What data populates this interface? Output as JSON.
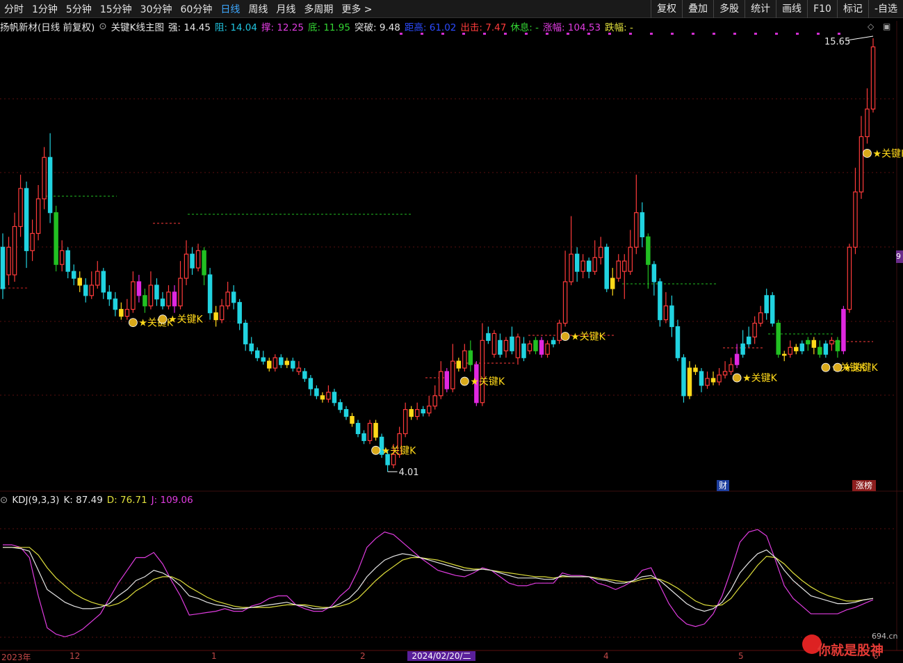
{
  "toolbar": {
    "periods": [
      "分时",
      "1分钟",
      "5分钟",
      "15分钟",
      "30分钟",
      "60分钟",
      "日线",
      "周线",
      "月线",
      "多周期",
      "更多 >"
    ],
    "active_period": "日线",
    "right_buttons": [
      "复权",
      "叠加",
      "多股",
      "统计",
      "画线",
      "F10",
      "标记",
      "-自选"
    ]
  },
  "info": {
    "stock": "扬帆新材(日线 前复权)",
    "indicator": "关键K线主图",
    "items": [
      {
        "label": "强:",
        "value": "14.45",
        "color": "#e6e6e6"
      },
      {
        "label": "阻:",
        "value": "14.04",
        "color": "#21c5e0"
      },
      {
        "label": "撑:",
        "value": "12.25",
        "color": "#e03ce0"
      },
      {
        "label": "底:",
        "value": "11.95",
        "color": "#33d633"
      },
      {
        "label": "突破:",
        "value": "9.48",
        "color": "#e6e6e6"
      },
      {
        "label": "距高:",
        "value": "61.02",
        "color": "#2c4bff"
      },
      {
        "label": "出击:",
        "value": "7.47",
        "color": "#ff3b3b"
      },
      {
        "label": "休息:",
        "value": "-",
        "color": "#33d633"
      },
      {
        "label": "涨幅:",
        "value": "104.53",
        "color": "#e03ce0"
      },
      {
        "label": "跌幅:",
        "value": "-",
        "color": "#e0e03c"
      }
    ]
  },
  "kdj": {
    "name": "KDJ(9,3,3)",
    "items": [
      {
        "label": "K:",
        "value": "87.49",
        "color": "#e6e6e6"
      },
      {
        "label": "D:",
        "value": "76.71",
        "color": "#e0e03c"
      },
      {
        "label": "J:",
        "value": "109.06",
        "color": "#e03ce0"
      }
    ]
  },
  "marks": {
    "high_label": "15.65",
    "low_label": "4.01",
    "key_k_label": "关键K",
    "cai_tag": "财",
    "zb_tag": "涨榜",
    "side_tag": "9"
  },
  "xaxis": {
    "labels": [
      "2023年",
      "12",
      "1",
      "2",
      "2024/02/20/二",
      "4",
      "5",
      "6"
    ]
  },
  "watermark": {
    "text": "你就是股神",
    "url": "694.cn"
  },
  "colors": {
    "up": "#ff3b3b",
    "down": "#21d3e0",
    "hl_down": "#22c022",
    "hl_up": "#e028e0",
    "yellow": "#ffd91a",
    "k": "#e6e6e6",
    "d": "#e0e03c",
    "j": "#e03ce0"
  },
  "chart_data": {
    "type": "candlestick",
    "price_range": [
      4.01,
      15.65
    ],
    "candles": [
      [
        8.4,
        9.6,
        10.0,
        8.1,
        "down"
      ],
      [
        9.6,
        8.8,
        9.9,
        8.5,
        "up"
      ],
      [
        8.8,
        10.2,
        10.6,
        8.6,
        "up"
      ],
      [
        10.2,
        11.3,
        11.7,
        9.9,
        "up"
      ],
      [
        11.3,
        9.5,
        11.5,
        9.0,
        "down"
      ],
      [
        9.5,
        10.0,
        10.4,
        9.2,
        "up"
      ],
      [
        10.0,
        11.0,
        11.4,
        9.8,
        "up"
      ],
      [
        11.0,
        12.2,
        12.5,
        10.7,
        "up"
      ],
      [
        12.2,
        10.6,
        12.9,
        10.3,
        "down"
      ],
      [
        10.6,
        9.1,
        10.8,
        8.9,
        "hlgreen"
      ],
      [
        9.1,
        9.5,
        9.8,
        8.9,
        "up"
      ],
      [
        9.5,
        8.9,
        9.6,
        8.7,
        "down"
      ],
      [
        8.9,
        8.7,
        9.1,
        8.5,
        "down"
      ],
      [
        8.7,
        8.5,
        8.9,
        8.3,
        "yellow"
      ],
      [
        8.5,
        8.2,
        8.7,
        8.0,
        "down"
      ],
      [
        8.2,
        8.5,
        8.9,
        8.1,
        "up"
      ],
      [
        8.5,
        8.9,
        9.2,
        8.4,
        "up"
      ],
      [
        8.9,
        8.3,
        9.0,
        8.1,
        "down"
      ],
      [
        8.3,
        8.1,
        8.5,
        7.9,
        "down"
      ],
      [
        8.1,
        7.8,
        8.3,
        7.6,
        "down"
      ],
      [
        7.8,
        7.6,
        8.0,
        7.5,
        "yellow"
      ],
      [
        7.6,
        7.8,
        8.1,
        7.5,
        "up"
      ],
      [
        7.8,
        8.6,
        8.9,
        7.7,
        "up"
      ],
      [
        8.6,
        8.2,
        8.8,
        8.0,
        "hlup"
      ],
      [
        8.2,
        7.9,
        8.4,
        7.7,
        "hlgreen"
      ],
      [
        7.9,
        8.5,
        8.9,
        7.8,
        "up"
      ],
      [
        8.5,
        8.1,
        8.7,
        7.9,
        "down"
      ],
      [
        8.1,
        7.9,
        8.3,
        7.8,
        "down"
      ],
      [
        7.9,
        8.3,
        8.5,
        7.8,
        "up"
      ],
      [
        8.3,
        7.9,
        8.5,
        7.7,
        "hlup"
      ],
      [
        7.9,
        8.7,
        9.2,
        7.8,
        "up"
      ],
      [
        8.7,
        9.4,
        9.8,
        8.5,
        "up"
      ],
      [
        9.4,
        9.0,
        9.6,
        8.8,
        "down"
      ],
      [
        9.0,
        9.5,
        9.7,
        8.9,
        "up"
      ],
      [
        9.5,
        8.8,
        9.6,
        8.5,
        "hlgreen"
      ],
      [
        8.8,
        7.7,
        9.0,
        7.5,
        "down"
      ],
      [
        7.7,
        7.5,
        7.9,
        7.3,
        "yellow"
      ],
      [
        7.5,
        7.9,
        8.1,
        7.4,
        "up"
      ],
      [
        7.9,
        8.3,
        8.6,
        7.8,
        "up"
      ],
      [
        8.3,
        8.0,
        8.5,
        7.8,
        "down"
      ],
      [
        8.0,
        7.4,
        8.1,
        7.2,
        "down"
      ],
      [
        7.4,
        6.8,
        7.5,
        6.6,
        "down"
      ],
      [
        6.8,
        6.6,
        7.0,
        6.5,
        "down"
      ],
      [
        6.6,
        6.4,
        6.7,
        6.3,
        "down"
      ],
      [
        6.4,
        6.3,
        6.6,
        6.2,
        "down"
      ],
      [
        6.3,
        6.1,
        6.4,
        6.0,
        "yellow"
      ],
      [
        6.1,
        6.4,
        6.5,
        6.0,
        "up"
      ],
      [
        6.4,
        6.2,
        6.5,
        6.1,
        "down"
      ],
      [
        6.2,
        6.3,
        6.4,
        6.1,
        "yellow"
      ],
      [
        6.3,
        6.1,
        6.4,
        6.0,
        "down"
      ],
      [
        6.1,
        6.0,
        6.3,
        5.9,
        "up"
      ],
      [
        6.0,
        5.8,
        6.1,
        5.7,
        "down"
      ],
      [
        5.8,
        5.5,
        5.9,
        5.3,
        "down"
      ],
      [
        5.5,
        5.3,
        5.6,
        5.2,
        "down"
      ],
      [
        5.3,
        5.2,
        5.4,
        5.1,
        "yellow"
      ],
      [
        5.2,
        5.4,
        5.6,
        5.1,
        "up"
      ],
      [
        5.4,
        5.1,
        5.5,
        5.0,
        "down"
      ],
      [
        5.1,
        4.9,
        5.2,
        4.8,
        "down"
      ],
      [
        4.9,
        4.7,
        5.0,
        4.6,
        "down"
      ],
      [
        4.7,
        4.5,
        4.8,
        4.4,
        "yellow"
      ],
      [
        4.5,
        4.2,
        4.6,
        4.1,
        "down"
      ],
      [
        4.2,
        4.0,
        4.3,
        3.9,
        "down"
      ],
      [
        4.0,
        4.5,
        4.6,
        3.9,
        "up"
      ],
      [
        4.5,
        4.1,
        4.6,
        4.0,
        "yellow"
      ],
      [
        4.1,
        3.6,
        4.2,
        3.5,
        "down"
      ],
      [
        3.6,
        3.3,
        3.7,
        3.1,
        "down"
      ],
      [
        3.3,
        3.6,
        3.9,
        3.2,
        "up"
      ],
      [
        3.6,
        4.2,
        4.4,
        3.5,
        "up"
      ],
      [
        4.2,
        4.9,
        5.1,
        4.1,
        "up"
      ],
      [
        4.9,
        4.7,
        5.0,
        4.6,
        "yellow"
      ],
      [
        4.7,
        4.9,
        5.1,
        4.6,
        "up"
      ],
      [
        4.9,
        4.8,
        5.0,
        4.7,
        "down"
      ],
      [
        4.8,
        5.0,
        5.3,
        4.7,
        "up"
      ],
      [
        5.0,
        5.3,
        5.6,
        4.9,
        "up"
      ],
      [
        5.3,
        6.0,
        6.3,
        5.2,
        "up"
      ],
      [
        6.0,
        5.5,
        6.1,
        5.4,
        "hlup"
      ],
      [
        5.5,
        6.3,
        6.8,
        5.4,
        "up"
      ],
      [
        6.3,
        6.1,
        6.4,
        6.0,
        "yellow"
      ],
      [
        6.1,
        6.6,
        6.8,
        6.0,
        "up"
      ],
      [
        6.6,
        6.2,
        6.9,
        6.0,
        "hlgreen"
      ],
      [
        6.2,
        5.1,
        6.3,
        5.0,
        "hlup"
      ],
      [
        5.1,
        6.9,
        7.4,
        5.0,
        "up"
      ],
      [
        6.9,
        7.1,
        7.3,
        6.8,
        "down"
      ],
      [
        7.1,
        6.5,
        7.2,
        6.4,
        "up"
      ],
      [
        6.5,
        6.9,
        7.1,
        6.4,
        "down"
      ],
      [
        6.9,
        6.6,
        7.0,
        6.4,
        "up"
      ],
      [
        6.6,
        7.0,
        7.3,
        6.5,
        "down"
      ],
      [
        7.0,
        6.4,
        7.1,
        6.2,
        "up"
      ],
      [
        6.4,
        6.8,
        7.0,
        6.3,
        "down"
      ],
      [
        6.8,
        6.6,
        6.9,
        6.5,
        "up"
      ],
      [
        6.6,
        6.9,
        7.0,
        6.5,
        "hlgreen"
      ],
      [
        6.9,
        6.5,
        7.0,
        6.4,
        "hlup"
      ],
      [
        6.5,
        6.8,
        6.9,
        6.4,
        "up"
      ],
      [
        6.8,
        6.9,
        7.0,
        6.7,
        "down"
      ],
      [
        6.9,
        7.4,
        7.5,
        6.8,
        "up"
      ],
      [
        7.4,
        8.6,
        9.5,
        7.3,
        "up"
      ],
      [
        8.6,
        9.4,
        10.5,
        8.5,
        "up"
      ],
      [
        9.4,
        8.9,
        9.6,
        8.6,
        "down"
      ],
      [
        8.9,
        9.2,
        9.4,
        8.7,
        "up"
      ],
      [
        9.2,
        8.9,
        9.3,
        8.7,
        "down"
      ],
      [
        8.9,
        9.3,
        9.8,
        8.8,
        "up"
      ],
      [
        9.3,
        9.6,
        9.9,
        9.1,
        "up"
      ],
      [
        9.6,
        8.4,
        9.7,
        8.3,
        "down"
      ],
      [
        8.4,
        8.7,
        9.0,
        8.2,
        "yellow"
      ],
      [
        8.7,
        9.2,
        9.4,
        8.6,
        "up"
      ],
      [
        9.2,
        8.9,
        9.4,
        8.1,
        "up"
      ],
      [
        8.9,
        9.6,
        10.1,
        8.8,
        "up"
      ],
      [
        9.6,
        10.6,
        11.7,
        9.4,
        "up"
      ],
      [
        10.6,
        9.9,
        10.9,
        9.6,
        "down"
      ],
      [
        9.9,
        9.1,
        10.0,
        8.4,
        "hlgreen"
      ],
      [
        9.1,
        8.6,
        9.2,
        8.2,
        "down"
      ],
      [
        8.6,
        7.5,
        8.7,
        7.3,
        "down"
      ],
      [
        7.5,
        7.9,
        8.3,
        7.4,
        "up"
      ],
      [
        7.9,
        7.3,
        8.2,
        7.0,
        "down"
      ],
      [
        7.3,
        6.4,
        7.5,
        6.3,
        "down"
      ],
      [
        6.4,
        5.3,
        6.5,
        5.1,
        "down"
      ],
      [
        5.3,
        6.1,
        6.3,
        5.2,
        "yellow"
      ],
      [
        6.1,
        6.0,
        6.2,
        5.9,
        "yellow"
      ],
      [
        6.0,
        5.6,
        6.1,
        5.4,
        "down"
      ],
      [
        5.6,
        5.8,
        6.0,
        5.5,
        "up"
      ],
      [
        5.8,
        5.7,
        6.0,
        5.6,
        "yellow"
      ],
      [
        5.7,
        5.9,
        6.1,
        5.6,
        "up"
      ],
      [
        5.9,
        6.0,
        6.3,
        5.8,
        "up"
      ],
      [
        6.0,
        6.2,
        6.4,
        5.9,
        "up"
      ],
      [
        6.2,
        6.5,
        6.8,
        6.1,
        "hlup"
      ],
      [
        6.5,
        6.8,
        7.2,
        6.4,
        "down"
      ],
      [
        6.8,
        7.0,
        7.3,
        6.7,
        "down"
      ],
      [
        7.0,
        7.4,
        7.6,
        6.8,
        "up"
      ],
      [
        7.4,
        7.7,
        7.9,
        7.3,
        "up"
      ],
      [
        7.7,
        8.2,
        8.4,
        7.5,
        "down"
      ],
      [
        8.2,
        7.4,
        8.3,
        7.3,
        "down"
      ],
      [
        7.4,
        6.5,
        7.5,
        6.4,
        "hlgreen"
      ],
      [
        6.5,
        6.5,
        6.6,
        6.3,
        "yellow"
      ],
      [
        6.5,
        6.7,
        6.9,
        6.4,
        "up"
      ],
      [
        6.7,
        6.6,
        6.8,
        6.5,
        "yellow"
      ],
      [
        6.6,
        6.8,
        6.9,
        6.5,
        "down"
      ],
      [
        6.8,
        6.9,
        7.0,
        6.6,
        "hlgreen"
      ],
      [
        6.9,
        6.7,
        7.0,
        6.5,
        "yellow"
      ],
      [
        6.7,
        6.5,
        6.9,
        6.4,
        "hlgreen"
      ],
      [
        6.5,
        6.8,
        6.9,
        6.4,
        "down"
      ],
      [
        6.8,
        6.9,
        7.0,
        6.6,
        "up"
      ],
      [
        6.9,
        6.6,
        7.0,
        6.4,
        "hlgreen"
      ],
      [
        6.6,
        7.8,
        7.9,
        6.5,
        "hlup"
      ],
      [
        7.8,
        9.6,
        9.7,
        7.7,
        "up"
      ],
      [
        9.6,
        11.2,
        11.9,
        9.4,
        "up"
      ],
      [
        11.2,
        12.8,
        13.4,
        11.0,
        "up"
      ],
      [
        12.8,
        13.6,
        14.2,
        12.6,
        "up"
      ],
      [
        13.6,
        15.4,
        15.65,
        13.5,
        "up"
      ]
    ],
    "kdj_series": {
      "K": [
        78,
        78,
        77,
        75,
        60,
        45,
        40,
        35,
        32,
        30,
        30,
        31,
        34,
        40,
        45,
        52,
        55,
        60,
        58,
        54,
        48,
        40,
        38,
        35,
        33,
        32,
        30,
        30,
        31,
        32,
        33,
        34,
        35,
        33,
        32,
        30,
        30,
        31,
        34,
        38,
        45,
        55,
        62,
        68,
        71,
        73,
        72,
        70,
        68,
        66,
        64,
        62,
        60,
        60,
        61,
        60,
        58,
        56,
        54,
        54,
        54,
        53,
        53,
        56,
        55,
        55,
        55,
        53,
        52,
        50,
        50,
        52,
        55,
        56,
        52,
        46,
        40,
        34,
        30,
        28,
        30,
        35,
        45,
        58,
        66,
        73,
        76,
        70,
        60,
        52,
        46,
        40,
        38,
        36,
        34,
        34,
        35,
        37,
        38
      ],
      "D": [
        78,
        78,
        78,
        78,
        72,
        62,
        54,
        48,
        42,
        38,
        35,
        33,
        32,
        34,
        38,
        44,
        48,
        53,
        55,
        55,
        52,
        47,
        43,
        39,
        36,
        34,
        32,
        31,
        31,
        31,
        31,
        32,
        33,
        33,
        33,
        32,
        31,
        31,
        32,
        34,
        38,
        45,
        52,
        58,
        63,
        68,
        70,
        70,
        69,
        68,
        66,
        64,
        62,
        61,
        61,
        60,
        59,
        58,
        57,
        56,
        55,
        55,
        54,
        55,
        55,
        55,
        55,
        54,
        53,
        52,
        51,
        51,
        53,
        54,
        53,
        50,
        46,
        41,
        36,
        33,
        32,
        33,
        38,
        47,
        55,
        64,
        71,
        70,
        65,
        58,
        52,
        47,
        43,
        40,
        38,
        36,
        36,
        37,
        38
      ],
      "J": [
        80,
        80,
        78,
        70,
        40,
        15,
        10,
        8,
        10,
        14,
        20,
        26,
        38,
        50,
        60,
        70,
        70,
        74,
        65,
        52,
        40,
        25,
        26,
        27,
        28,
        30,
        28,
        28,
        32,
        34,
        38,
        40,
        40,
        33,
        30,
        28,
        28,
        32,
        40,
        46,
        60,
        78,
        85,
        90,
        88,
        82,
        76,
        70,
        65,
        60,
        58,
        56,
        55,
        58,
        62,
        60,
        55,
        50,
        48,
        48,
        50,
        50,
        50,
        58,
        56,
        56,
        55,
        50,
        48,
        45,
        48,
        52,
        60,
        62,
        48,
        34,
        24,
        18,
        16,
        18,
        26,
        40,
        60,
        82,
        90,
        92,
        87,
        68,
        48,
        38,
        32,
        26,
        26,
        26,
        26,
        29,
        31,
        34,
        37
      ]
    },
    "xaxis_labels": [
      "2023年",
      "12",
      "1",
      "2",
      "2024/02/20/二",
      "4",
      "5",
      "6"
    ]
  }
}
